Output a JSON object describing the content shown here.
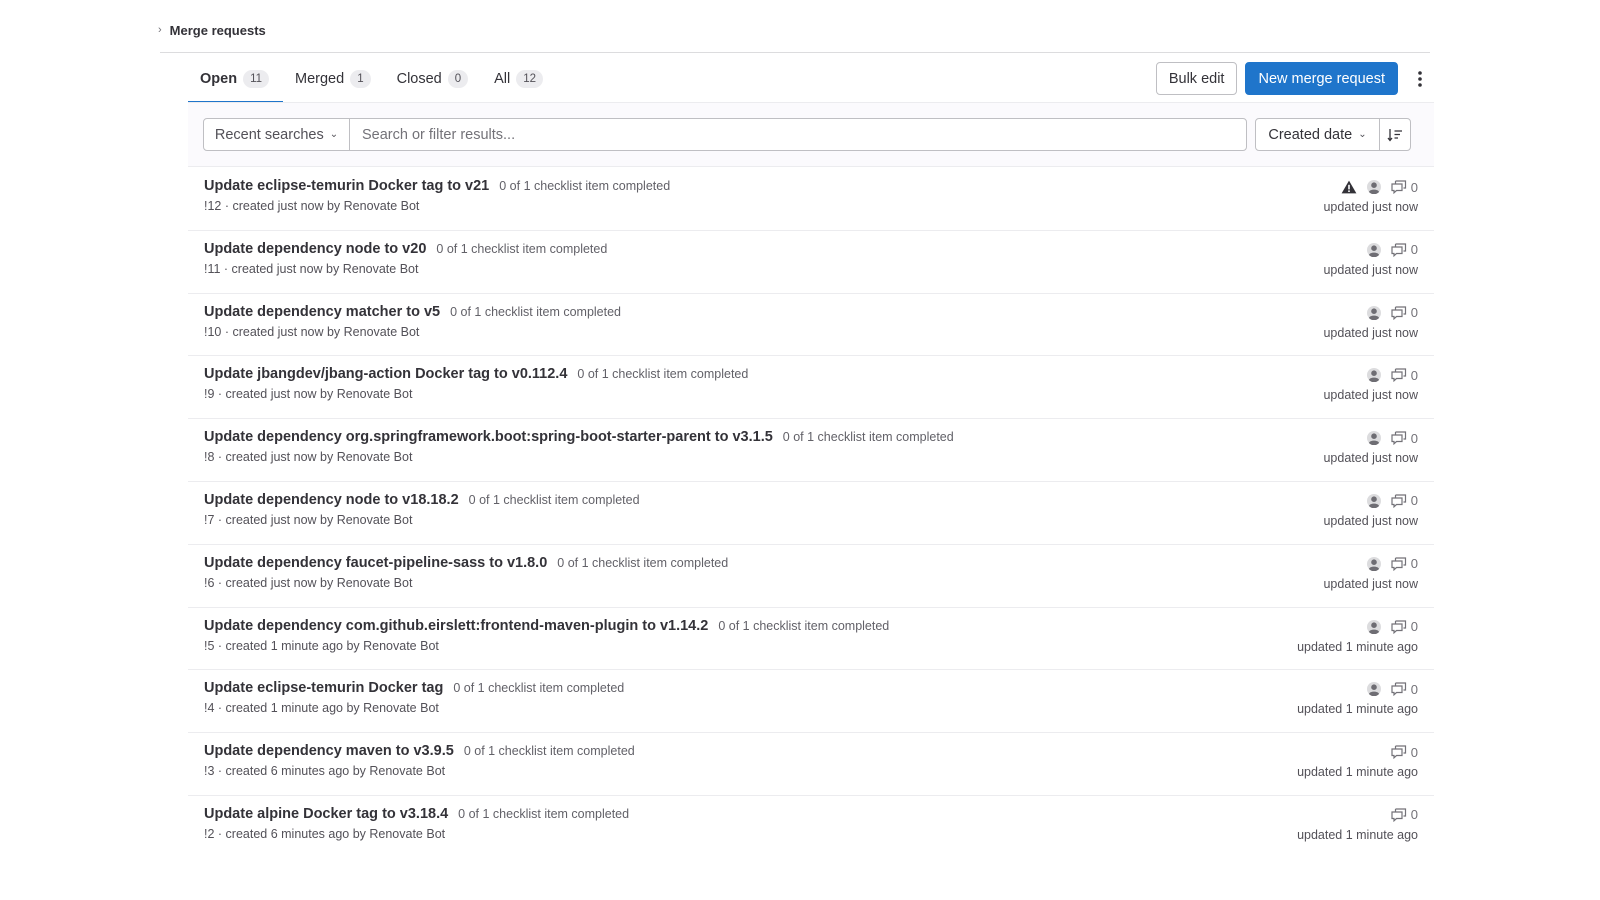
{
  "breadcrumb": {
    "current": "Merge requests"
  },
  "tabs": [
    {
      "label": "Open",
      "count": "11"
    },
    {
      "label": "Merged",
      "count": "1"
    },
    {
      "label": "Closed",
      "count": "0"
    },
    {
      "label": "All",
      "count": "12"
    }
  ],
  "actions": {
    "bulk_edit": "Bulk edit",
    "new_mr": "New merge request"
  },
  "filter": {
    "recent_searches": "Recent searches",
    "placeholder": "Search or filter results...",
    "sort_label": "Created date"
  },
  "icons": {
    "warning": "warning-icon",
    "avatar": "avatar-icon",
    "comments": "comments-icon",
    "sort_direction": "sort-lowest-icon",
    "kebab": "more-vertical-icon",
    "chevron": "chevron-right-icon"
  },
  "merge_requests": [
    {
      "title": "Update eclipse-temurin Docker tag to v21",
      "checklist": "0 of 1 checklist item completed",
      "meta": "!12 · created just now by Renovate Bot",
      "updated": "updated just now",
      "comments": "0",
      "warning": true,
      "avatar": true
    },
    {
      "title": "Update dependency node to v20",
      "checklist": "0 of 1 checklist item completed",
      "meta": "!11 · created just now by Renovate Bot",
      "updated": "updated just now",
      "comments": "0",
      "warning": false,
      "avatar": true
    },
    {
      "title": "Update dependency matcher to v5",
      "checklist": "0 of 1 checklist item completed",
      "meta": "!10 · created just now by Renovate Bot",
      "updated": "updated just now",
      "comments": "0",
      "warning": false,
      "avatar": true
    },
    {
      "title": "Update jbangdev/jbang-action Docker tag to v0.112.4",
      "checklist": "0 of 1 checklist item completed",
      "meta": "!9 · created just now by Renovate Bot",
      "updated": "updated just now",
      "comments": "0",
      "warning": false,
      "avatar": true
    },
    {
      "title": "Update dependency org.springframework.boot:spring-boot-starter-parent to v3.1.5",
      "checklist": "0 of 1 checklist item completed",
      "meta": "!8 · created just now by Renovate Bot",
      "updated": "updated just now",
      "comments": "0",
      "warning": false,
      "avatar": true
    },
    {
      "title": "Update dependency node to v18.18.2",
      "checklist": "0 of 1 checklist item completed",
      "meta": "!7 · created just now by Renovate Bot",
      "updated": "updated just now",
      "comments": "0",
      "warning": false,
      "avatar": true
    },
    {
      "title": "Update dependency faucet-pipeline-sass to v1.8.0",
      "checklist": "0 of 1 checklist item completed",
      "meta": "!6 · created just now by Renovate Bot",
      "updated": "updated just now",
      "comments": "0",
      "warning": false,
      "avatar": true
    },
    {
      "title": "Update dependency com.github.eirslett:frontend-maven-plugin to v1.14.2",
      "checklist": "0 of 1 checklist item completed",
      "meta": "!5 · created 1 minute ago by Renovate Bot",
      "updated": "updated 1 minute ago",
      "comments": "0",
      "warning": false,
      "avatar": true
    },
    {
      "title": "Update eclipse-temurin Docker tag",
      "checklist": "0 of 1 checklist item completed",
      "meta": "!4 · created 1 minute ago by Renovate Bot",
      "updated": "updated 1 minute ago",
      "comments": "0",
      "warning": false,
      "avatar": true
    },
    {
      "title": "Update dependency maven to v3.9.5",
      "checklist": "0 of 1 checklist item completed",
      "meta": "!3 · created 6 minutes ago by Renovate Bot",
      "updated": "updated 1 minute ago",
      "comments": "0",
      "warning": false,
      "avatar": false
    },
    {
      "title": "Update alpine Docker tag to v3.18.4",
      "checklist": "0 of 1 checklist item completed",
      "meta": "!2 · created 6 minutes ago by Renovate Bot",
      "updated": "updated 1 minute ago",
      "comments": "0",
      "warning": false,
      "avatar": false
    }
  ],
  "colors": {
    "accent": "#1f75cb",
    "text": "#333238",
    "muted": "#535158"
  }
}
